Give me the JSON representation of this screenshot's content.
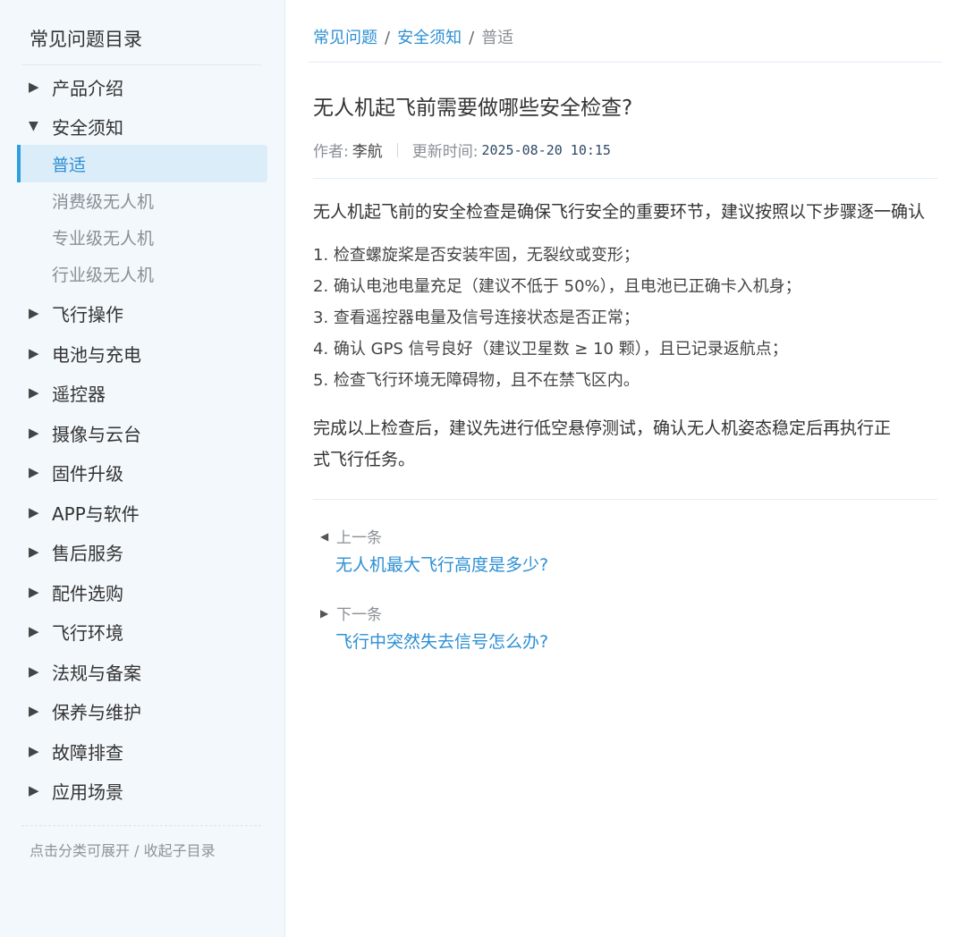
{
  "sidebar": {
    "title": "常见问题目录",
    "categories": [
      {
        "label": "产品介绍",
        "expanded": false
      },
      {
        "label": "安全须知",
        "expanded": true,
        "children": [
          "普适",
          "消费级无人机",
          "专业级无人机",
          "行业级无人机"
        ],
        "active_child": "普适"
      },
      {
        "label": "飞行操作",
        "expanded": false
      },
      {
        "label": "电池与充电",
        "expanded": false
      },
      {
        "label": "遥控器",
        "expanded": false
      },
      {
        "label": "摄像与云台",
        "expanded": false
      },
      {
        "label": "固件升级",
        "expanded": false
      },
      {
        "label": "APP与软件",
        "expanded": false
      },
      {
        "label": "售后服务",
        "expanded": false
      },
      {
        "label": "配件选购",
        "expanded": false
      },
      {
        "label": "飞行环境",
        "expanded": false
      },
      {
        "label": "法规与备案",
        "expanded": false
      },
      {
        "label": "保养与维护",
        "expanded": false
      },
      {
        "label": "故障排查",
        "expanded": false
      },
      {
        "label": "应用场景",
        "expanded": false
      }
    ],
    "hint": "点击分类可展开 / 收起子目录"
  },
  "breadcrumb": {
    "items": [
      "常见问题",
      "安全须知"
    ],
    "separator": "/",
    "current": "普适"
  },
  "article": {
    "title": "无人机起飞前需要做哪些安全检查?",
    "author_label": "作者:",
    "author": "李航",
    "time_label": "更新时间:",
    "time": "2025-08-20 10:15",
    "intro": "无人机起飞前的安全检查是确保飞行安全的重要环节，建议按照以下步骤逐一确认",
    "steps": [
      "1. 检查螺旋桨是否安装牢固，无裂纹或变形；",
      "2. 确认电池电量充足（建议不低于 50%），且电池已正确卡入机身；",
      "3. 查看遥控器电量及信号连接状态是否正常；",
      "4. 确认 GPS 信号良好（建议卫星数 ≥ 10 颗），且已记录返航点；",
      "5. 检查飞行环境无障碍物，且不在禁飞区内。"
    ],
    "conclusion": "完成以上检查后，建议先进行低空悬停测试，确认无人机姿态稳定后再执行正式飞行任务。"
  },
  "pager": {
    "prev_label": "上一条",
    "prev_title": "无人机最大飞行高度是多少?",
    "next_label": "下一条",
    "next_title": "飞行中突然失去信号怎么办?"
  },
  "colors": {
    "accent": "#2d8fd3",
    "sidebar_bg": "#f3f8fc",
    "active_bg": "#dcedfa",
    "active_bar": "#2d9fe0"
  }
}
